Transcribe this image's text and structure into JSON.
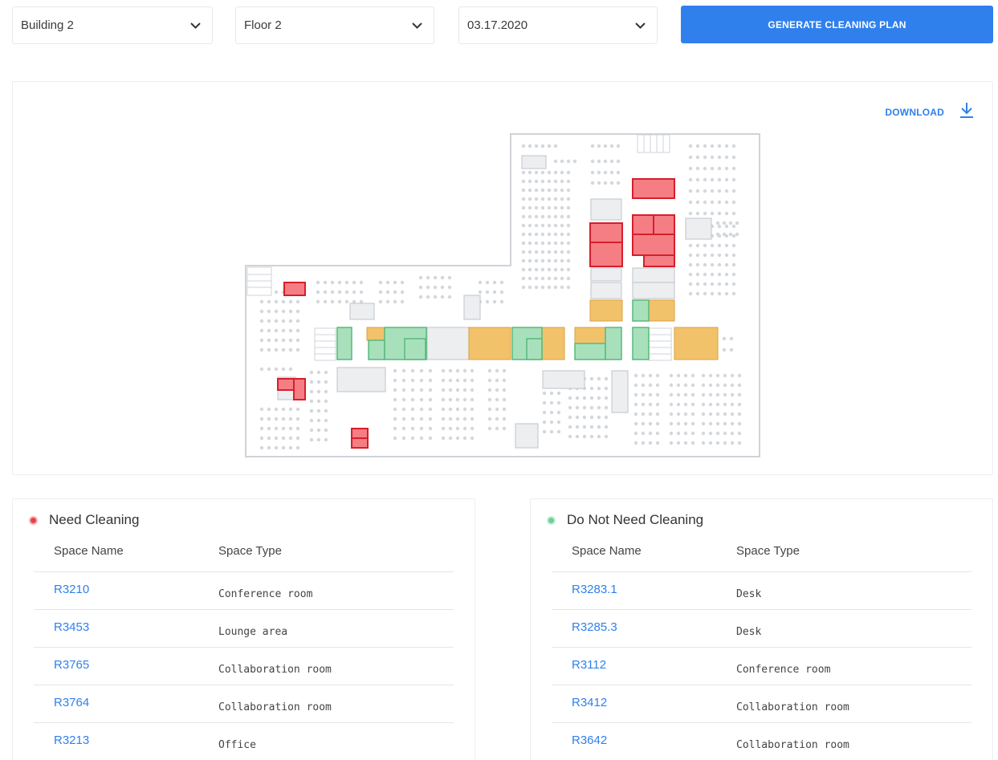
{
  "filters": {
    "building": "Building 2",
    "floor": "Floor 2",
    "date": "03.17.2020"
  },
  "generate_button": "GENERATE CLEANING PLAN",
  "download_label": "DOWNLOAD",
  "colors": {
    "accent": "#2f80ed",
    "need_cleaning": "#e8424a",
    "clean": "#6fcf97",
    "partial": "#f2c26b"
  },
  "need_cleaning": {
    "title": "Need Cleaning",
    "col_name": "Space Name",
    "col_type": "Space Type",
    "rows": [
      {
        "name": "R3210",
        "type": "Conference room"
      },
      {
        "name": "R3453",
        "type": "Lounge area"
      },
      {
        "name": "R3765",
        "type": "Collaboration room"
      },
      {
        "name": "R3764",
        "type": "Collaboration room"
      },
      {
        "name": "R3213",
        "type": "Office"
      }
    ]
  },
  "no_cleaning": {
    "title": "Do Not Need Cleaning",
    "col_name": "Space Name",
    "col_type": "Space Type",
    "rows": [
      {
        "name": "R3283.1",
        "type": "Desk"
      },
      {
        "name": "R3285.3",
        "type": "Desk"
      },
      {
        "name": "R3112",
        "type": "Conference room"
      },
      {
        "name": "R3412",
        "type": "Collaboration room"
      },
      {
        "name": "R3642",
        "type": "Collaboration room"
      }
    ]
  }
}
